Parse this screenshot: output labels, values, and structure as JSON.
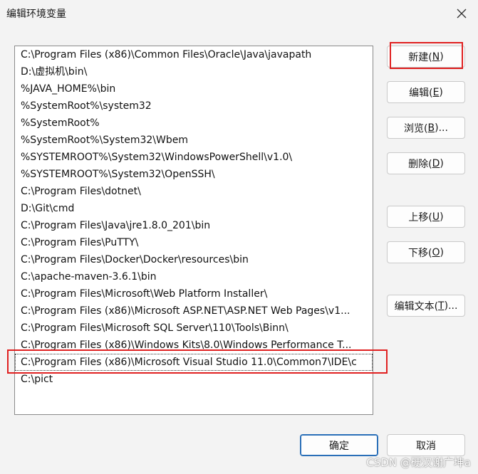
{
  "window": {
    "title": "编辑环境变量"
  },
  "paths": [
    "C:\\Program Files (x86)\\Common Files\\Oracle\\Java\\javapath",
    "D:\\虚拟机\\bin\\",
    "%JAVA_HOME%\\bin",
    "%SystemRoot%\\system32",
    "%SystemRoot%",
    "%SystemRoot%\\System32\\Wbem",
    "%SYSTEMROOT%\\System32\\WindowsPowerShell\\v1.0\\",
    "%SYSTEMROOT%\\System32\\OpenSSH\\",
    "C:\\Program Files\\dotnet\\",
    "D:\\Git\\cmd",
    "C:\\Program Files\\Java\\jre1.8.0_201\\bin",
    "C:\\Program Files\\PuTTY\\",
    "C:\\Program Files\\Docker\\Docker\\resources\\bin",
    "C:\\apache-maven-3.6.1\\bin",
    "C:\\Program Files\\Microsoft\\Web Platform Installer\\",
    "C:\\Program Files (x86)\\Microsoft ASP.NET\\ASP.NET Web Pages\\v1...",
    "C:\\Program Files\\Microsoft SQL Server\\110\\Tools\\Binn\\",
    "C:\\Program Files (x86)\\Windows Kits\\8.0\\Windows Performance T...",
    "C:\\Program Files (x86)\\Microsoft Visual Studio 11.0\\Common7\\IDE\\c",
    "C:\\pict"
  ],
  "buttons": {
    "new_label": "新建(",
    "new_key": "N",
    "edit_label": "编辑(",
    "edit_key": "E",
    "browse_label": "浏览(",
    "browse_key": "B",
    "browse_suffix": ")...",
    "delete_label": "删除(",
    "delete_key": "D",
    "move_up_label": "上移(",
    "move_up_key": "U",
    "move_down_label": "下移(",
    "move_down_key": "O",
    "edit_text_label": "编辑文本(",
    "edit_text_key": "T",
    "edit_text_suffix": ")...",
    "close_paren": ")",
    "ok_label": "确定",
    "cancel_label": "取消"
  },
  "watermark": "CSDN @硬汉谢广坤a",
  "colors": {
    "annotation": "#e02020",
    "ok_border": "#2a6fb8"
  }
}
